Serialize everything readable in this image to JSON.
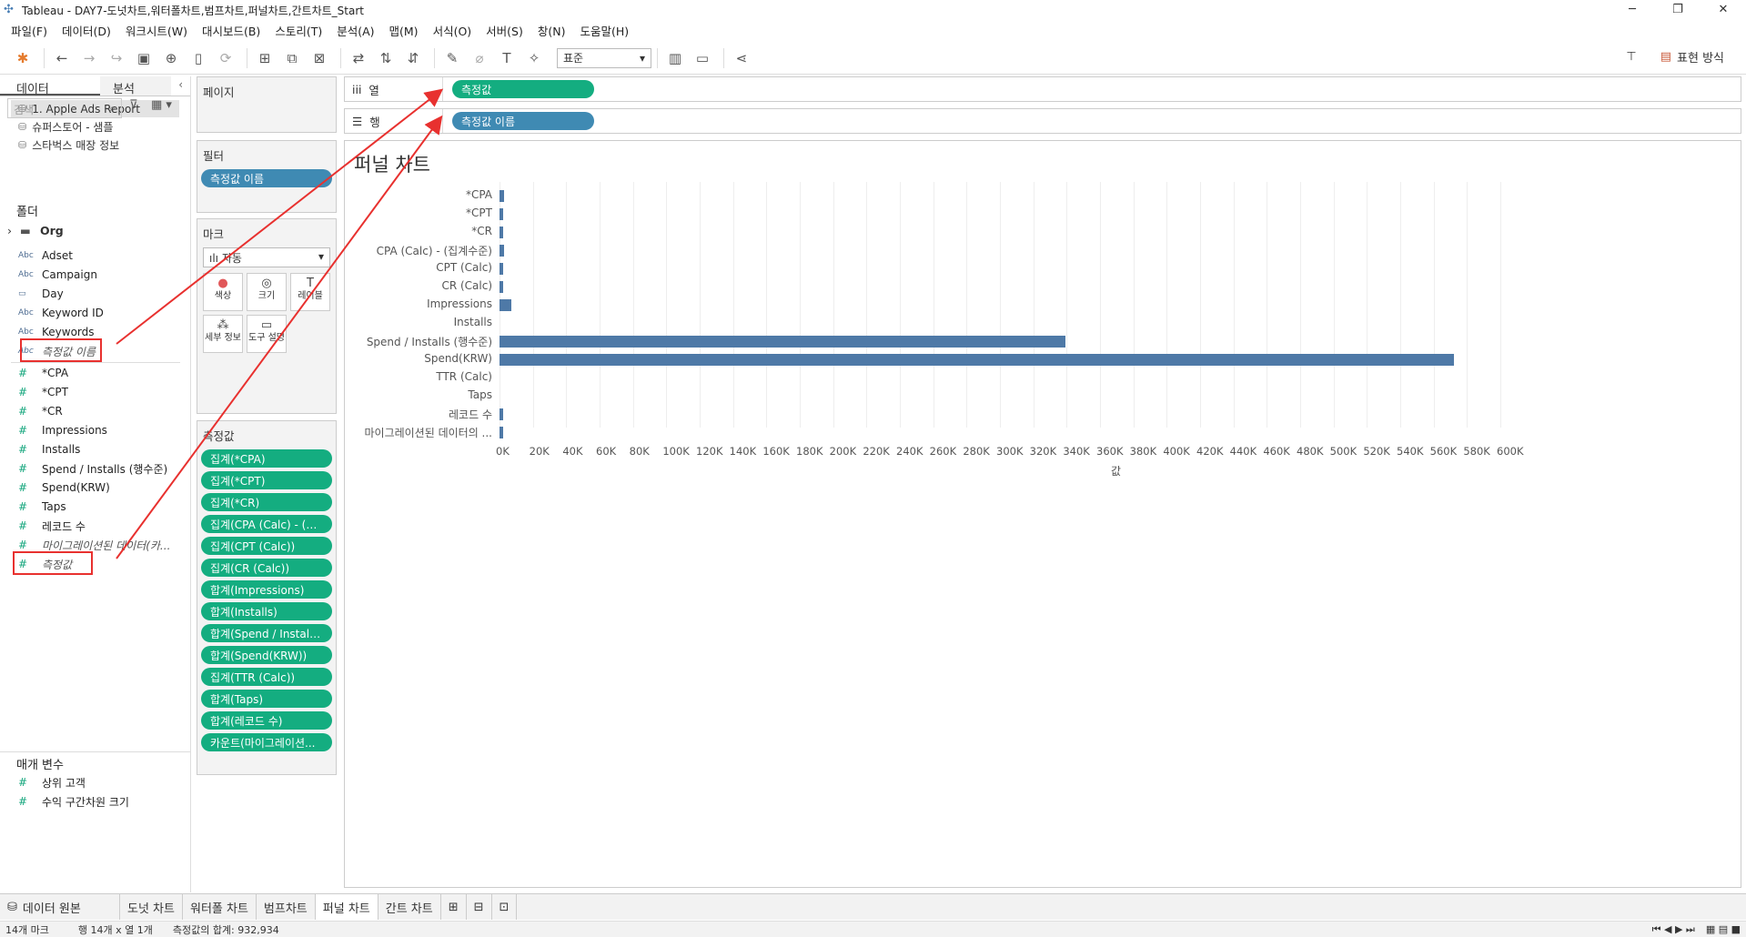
{
  "window": {
    "title": "Tableau - DAY7-도넛차트,워터폴차트,범프차트,퍼널차트,간트차트_Start"
  },
  "menu": [
    "파일(F)",
    "데이터(D)",
    "워크시트(W)",
    "대시보드(B)",
    "스토리(T)",
    "분석(A)",
    "맵(M)",
    "서식(O)",
    "서버(S)",
    "창(N)",
    "도움말(H)"
  ],
  "toolbar": {
    "fit_select": "표준",
    "show_me": "표현 방식"
  },
  "data_pane": {
    "tab_data": "데이터",
    "tab_analysis": "분석",
    "sources": [
      "1. Apple Ads Report",
      "슈퍼스토어 - 샘플",
      "스타벅스 매장 정보"
    ],
    "search_placeholder": "검색",
    "folders_label": "폴더",
    "folder_name": "Org",
    "dimensions": [
      {
        "icon": "Abc",
        "name": "Adset"
      },
      {
        "icon": "Abc",
        "name": "Campaign"
      },
      {
        "icon": "calendar",
        "name": "Day"
      },
      {
        "icon": "Abc",
        "name": "Keyword ID"
      },
      {
        "icon": "Abc",
        "name": "Keywords"
      },
      {
        "icon": "Abc",
        "name": "측정값 이름"
      }
    ],
    "measures": [
      "*CPA",
      "*CPT",
      "*CR",
      "Impressions",
      "Installs",
      "Spend / Installs (행수준)",
      "Spend(KRW)",
      "Taps",
      "레코드 수",
      "마이그레이션된 데이터(카...",
      "측정값"
    ],
    "params_label": "매개 변수",
    "params": [
      "상위 고객",
      "수익 구간차원 크기"
    ]
  },
  "pages": {
    "title": "페이지"
  },
  "filters": {
    "title": "필터",
    "pill": "측정값 이름"
  },
  "marks": {
    "title": "마크",
    "type": "자동",
    "buttons": [
      "색상",
      "크기",
      "레이블",
      "세부 정보",
      "도구 설명"
    ]
  },
  "measure_values": {
    "title": "측정값",
    "pills": [
      "집계(*CPA)",
      "집계(*CPT)",
      "집계(*CR)",
      "집계(CPA (Calc) - (집...",
      "집계(CPT (Calc))",
      "집계(CR (Calc))",
      "합계(Impressions)",
      "합계(Installs)",
      "합계(Spend / Installs ...",
      "합계(Spend(KRW))",
      "집계(TTR (Calc))",
      "합계(Taps)",
      "합계(레코드 수)",
      "카운트(마이그레이션..."
    ]
  },
  "shelves": {
    "columns_label": "열",
    "columns_pill": "측정값",
    "rows_label": "행",
    "rows_pill": "측정값 이름"
  },
  "view_title": "퍼널 차트",
  "colors": {
    "bar": "#4e79a7",
    "measure_pill": "#14ad80",
    "dimension_pill": "#3f8ab3",
    "annotation": "#e8312f"
  },
  "chart_data": {
    "type": "bar",
    "categories": [
      "*CPA",
      "*CPT",
      "*CR",
      "CPA (Calc) - (집계수준)",
      "CPT (Calc)",
      "CR (Calc)",
      "Impressions",
      "Installs",
      "Spend / Installs (행수준)",
      "Spend(KRW)",
      "TTR (Calc)",
      "Taps",
      "레코드 수",
      "마이그레이션된 데이터의 ..."
    ],
    "values": [
      2500,
      1200,
      2,
      2500,
      1200,
      2,
      7000,
      0,
      339000,
      572000,
      0,
      0,
      1500,
      1200
    ],
    "xlabel": "값",
    "xlim": [
      0,
      600000
    ],
    "ticks": [
      "0K",
      "20K",
      "40K",
      "60K",
      "80K",
      "100K",
      "120K",
      "140K",
      "160K",
      "180K",
      "200K",
      "220K",
      "240K",
      "260K",
      "280K",
      "300K",
      "320K",
      "340K",
      "360K",
      "380K",
      "400K",
      "420K",
      "440K",
      "460K",
      "480K",
      "500K",
      "520K",
      "540K",
      "560K",
      "580K",
      "600K"
    ]
  },
  "sheet_tabs": {
    "source": "데이터 원본",
    "tabs": [
      "도넛 차트",
      "워터폴 차트",
      "범프차트",
      "퍼널 차트",
      "간트 차트"
    ],
    "active": "퍼널 차트"
  },
  "status": {
    "marks": "14개 마크",
    "rows_cols": "행 14개 x 열 1개",
    "sum": "측정값의 합계: 932,934"
  }
}
